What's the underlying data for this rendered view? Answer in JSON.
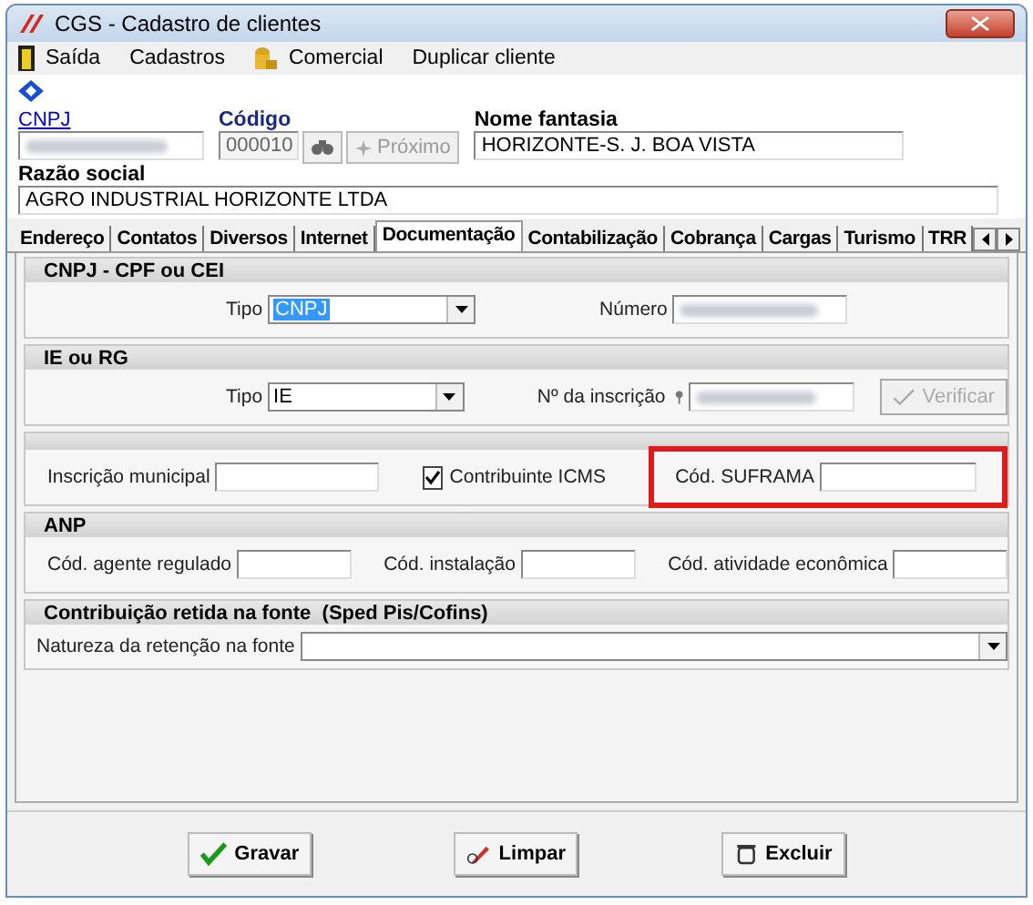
{
  "window": {
    "title": "CGS - Cadastro de clientes"
  },
  "menu": [
    {
      "label": "Saída"
    },
    {
      "label": "Cadastros"
    },
    {
      "label": "Comercial"
    },
    {
      "label": "Duplicar cliente"
    }
  ],
  "header": {
    "cnpj_label": "CNPJ",
    "codigo_label": "Código",
    "codigo_value": "000010",
    "proximo_label": "Próximo",
    "nome_fantasia_label": "Nome fantasia",
    "nome_fantasia_value": "HORIZONTE-S. J. BOA VISTA",
    "razao_social_label": "Razão social",
    "razao_social_value": "AGRO INDUSTRIAL HORIZONTE LTDA"
  },
  "tabs": [
    {
      "label": "Endereço",
      "selected": false
    },
    {
      "label": "Contatos",
      "selected": false
    },
    {
      "label": "Diversos",
      "selected": false
    },
    {
      "label": "Internet",
      "selected": false
    },
    {
      "label": "Documentação",
      "selected": true
    },
    {
      "label": "Contabilização",
      "selected": false
    },
    {
      "label": "Cobrança",
      "selected": false
    },
    {
      "label": "Cargas",
      "selected": false
    },
    {
      "label": "Turismo",
      "selected": false
    },
    {
      "label": "TRR",
      "selected": false
    }
  ],
  "cnpj_section": {
    "title": "CNPJ - CPF ou CEI",
    "tipo_label": "Tipo",
    "tipo_value": "CNPJ",
    "numero_label": "Número"
  },
  "ie_section": {
    "title": "IE ou RG",
    "tipo_label": "Tipo",
    "tipo_value": "IE",
    "inscricao_label": "Nº da inscrição",
    "verify_button": {
      "label": "Verificar",
      "disabled": true
    }
  },
  "other_section": {
    "municipal_label": "Inscrição municipal",
    "icms_label": "Contribuinte ICMS",
    "icms_checked": true,
    "suframa_label": "Cód. SUFRAMA",
    "suframa_highlighted": true
  },
  "anp_section": {
    "title": "ANP",
    "fields": [
      {
        "label": "Cód. agente regulado"
      },
      {
        "label": "Cód. instalação"
      },
      {
        "label": "Cód. atividade econômica"
      }
    ]
  },
  "retention_section": {
    "title": "Contribuição retida na fonte  (Sped Pis/Cofins)",
    "natureza_label": "Natureza da retenção na fonte"
  },
  "buttons": [
    {
      "label": "Gravar"
    },
    {
      "label": "Limpar"
    },
    {
      "label": "Excluir"
    }
  ]
}
